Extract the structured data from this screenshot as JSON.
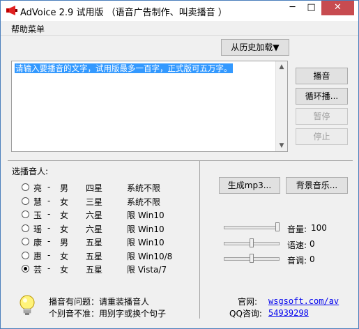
{
  "window": {
    "title": "AdVoice 2.9 试用版 （语音广告制作、叫卖播音 ）",
    "minimize": "─",
    "maximize": "□",
    "close": "✕"
  },
  "menu": {
    "help": "帮助菜单"
  },
  "history_button": "从历史加载▼",
  "text_area": {
    "content": "请输入要播音的文字，试用版最多一百字，正式版可五万字。"
  },
  "buttons": {
    "play": "播音",
    "loop": "循环播...",
    "pause": "暂停",
    "stop": "停止",
    "mp3": "生成mp3...",
    "bgm": "背景音乐..."
  },
  "voice_section": {
    "label": "选播音人:",
    "voices": [
      {
        "name": "亮",
        "gender": "男",
        "stars": "四星",
        "compat": "系统不限",
        "selected": false
      },
      {
        "name": "慧",
        "gender": "女",
        "stars": "三星",
        "compat": "系统不限",
        "selected": false
      },
      {
        "name": "玉",
        "gender": "女",
        "stars": "六星",
        "compat": "限 Win10",
        "selected": false
      },
      {
        "name": "瑶",
        "gender": "女",
        "stars": "六星",
        "compat": "限 Win10",
        "selected": false
      },
      {
        "name": "康",
        "gender": "男",
        "stars": "五星",
        "compat": "限 Win10",
        "selected": false
      },
      {
        "name": "惠",
        "gender": "女",
        "stars": "五星",
        "compat": "限 Win10/8",
        "selected": false
      },
      {
        "name": "芸",
        "gender": "女",
        "stars": "五星",
        "compat": "限 Vista/7",
        "selected": true
      }
    ]
  },
  "sliders": {
    "volume": {
      "label": "音量:",
      "value": "100",
      "level": 1.0
    },
    "speed": {
      "label": "语速:",
      "value": "0",
      "level": 0.5
    },
    "pitch": {
      "label": "音调:",
      "value": "0",
      "level": 0.5
    }
  },
  "tips": {
    "line1": "播音有问题：请重装播音人",
    "line2": "个别音不准：用别字或换个句子"
  },
  "contact": {
    "website_label": "官网:",
    "website": "wsgsoft.com/av",
    "qq_label": "QQ咨询:",
    "qq": "54939298"
  },
  "colors": {
    "selection": "#3399ff",
    "close": "#c74b50",
    "link": "#0000ee"
  }
}
